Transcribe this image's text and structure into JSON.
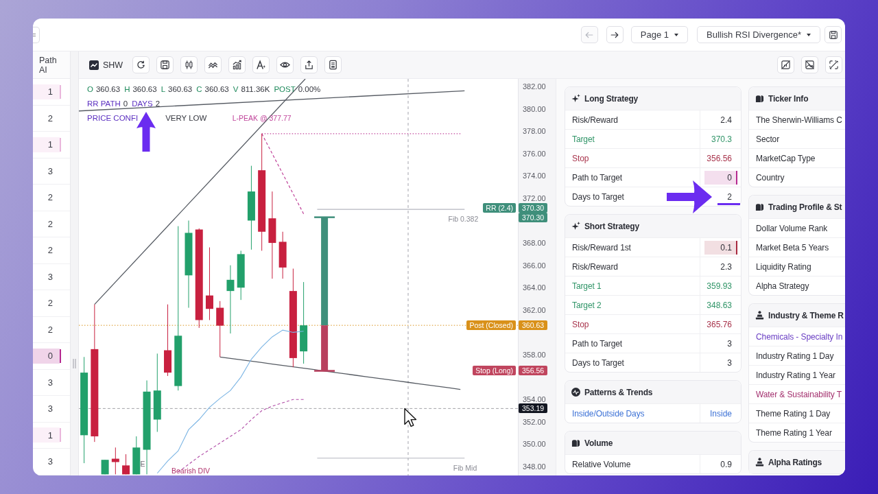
{
  "top_bar": {
    "back_button": {
      "disabled": true
    },
    "forward_button": {
      "disabled": false
    },
    "page_menu": {
      "value": "Page 1"
    },
    "scan_menu": {
      "value": "Bullish RSI Divergence*"
    }
  },
  "path_ai": {
    "header": "Path AI",
    "rows": [
      {
        "value": "1",
        "color": "#e9b6dc"
      },
      {
        "value": "2"
      },
      {
        "value": "1",
        "color": "#e9b6dc"
      },
      {
        "value": "3"
      },
      {
        "value": "2"
      },
      {
        "value": "2"
      },
      {
        "value": "2"
      },
      {
        "value": "3"
      },
      {
        "value": "2"
      },
      {
        "value": "2"
      },
      {
        "value": "0",
        "color": "#b5288f"
      },
      {
        "value": "3"
      },
      {
        "value": "3"
      },
      {
        "value": "1",
        "color": "#e9b6dc"
      },
      {
        "value": "3"
      }
    ]
  },
  "toolbar": {
    "symbol": "SHW"
  },
  "chart": {
    "info": {
      "quote": [
        {
          "key": "O",
          "value": "360.63"
        },
        {
          "key": "H",
          "value": "360.63"
        },
        {
          "key": "L",
          "value": "360.63"
        },
        {
          "key": "C",
          "value": "360.63"
        },
        {
          "key": "V",
          "value": "811.36K"
        },
        {
          "key": "POST",
          "value": "0.00%"
        }
      ],
      "path": [
        {
          "key": "RR PATH",
          "value": "0",
          "highlighted": false
        },
        {
          "key": "DAYS",
          "value": "2",
          "highlighted": true
        }
      ],
      "confidence": {
        "key": "PRICE CONFI",
        "value": "VERY LOW"
      }
    },
    "chart_data": {
      "type": "candlestick",
      "tick_labels": "y",
      "ylim": [
        347.2,
        382.67
      ],
      "yticks": [
        {
          "value": 382,
          "label": "382.00"
        },
        {
          "value": 380,
          "label": "380.00"
        },
        {
          "value": 378,
          "label": "378.00"
        },
        {
          "value": 376,
          "label": "376.00"
        },
        {
          "value": 374,
          "label": "374.00"
        },
        {
          "value": 372,
          "label": "372.00"
        },
        {
          "value": 368,
          "label": "368.00"
        },
        {
          "value": 366,
          "label": "366.00"
        },
        {
          "value": 364,
          "label": "364.00"
        },
        {
          "value": 362,
          "label": "362.00"
        },
        {
          "value": 358,
          "label": "358.00"
        },
        {
          "value": 354,
          "label": "354.00"
        },
        {
          "value": 352,
          "label": "352.00"
        },
        {
          "value": 350,
          "label": "350.00"
        },
        {
          "value": 348,
          "label": "348.00"
        }
      ],
      "categories": [
        null,
        null,
        null,
        null,
        null,
        null,
        null,
        null,
        null,
        null,
        null,
        null,
        null,
        null,
        null,
        null,
        null,
        null,
        null,
        null,
        null,
        null,
        null,
        null,
        null,
        null,
        null,
        null,
        null,
        null,
        null,
        null,
        null,
        null,
        null,
        null,
        null,
        null,
        null,
        null,
        null,
        null
      ],
      "ohlc": [
        [
          350.8,
          357.8,
          348.3,
          356.4
        ],
        [
          358.5,
          362.5,
          350.2,
          350.7
        ],
        [
          347.3,
          348.6,
          347.3,
          348.6
        ],
        [
          348.7,
          349.7,
          347.3,
          348.4
        ],
        [
          348.1,
          349.1,
          347.3,
          347.3
        ],
        [
          347.3,
          350.7,
          347.3,
          349.7
        ],
        [
          349.5,
          355.7,
          347.3,
          354.7
        ],
        [
          352.2,
          358.1,
          351.1,
          354.8
        ],
        [
          358.4,
          362.5,
          356.1,
          356.4
        ],
        [
          355.2,
          369.5,
          354.8,
          359.7
        ],
        [
          365.1,
          370.0,
          362.2,
          368.9
        ],
        [
          369.2,
          369.3,
          360.4,
          361.1
        ],
        [
          363.3,
          367.6,
          361.1,
          362.1
        ],
        [
          362.2,
          362.8,
          357.8,
          360.6
        ],
        [
          363.7,
          366.0,
          359.9,
          364.7
        ],
        [
          364.0,
          367.3,
          362.9,
          367.0
        ],
        [
          370.0,
          374.9,
          367.4,
          372.6
        ],
        [
          374.5,
          377.77,
          367.3,
          369.0
        ],
        [
          370.2,
          372.6,
          364.8,
          368.0
        ],
        [
          368.1,
          369.0,
          364.8,
          365.8
        ],
        [
          363.7,
          365.7,
          356.9,
          357.7
        ],
        [
          358.3,
          364.5,
          357.2,
          360.63
        ],
        null,
        null,
        null,
        null,
        null,
        null,
        null,
        null,
        null,
        null,
        null,
        null,
        null,
        null,
        null,
        null,
        null,
        null,
        null,
        null
      ],
      "series": [
        {
          "type": "line",
          "color": "#7cb5e4",
          "line_style": "solid",
          "values": [
            null,
            null,
            null,
            null,
            null,
            null,
            null,
            347.4,
            348.5,
            349.4,
            351.3,
            352.2,
            353.3,
            354.1,
            354.8,
            356.0,
            357.6,
            358.7,
            359.6,
            360.2,
            360.0,
            360.1,
            null,
            null,
            null,
            null,
            null,
            null,
            null,
            null,
            null,
            null,
            null,
            null,
            null,
            null,
            null,
            null,
            null,
            null,
            null,
            null
          ]
        },
        {
          "type": "line",
          "color": "#b04aa6",
          "line_style": "dashed",
          "values": [
            null,
            null,
            null,
            null,
            null,
            null,
            null,
            null,
            null,
            347.5,
            348.2,
            348.9,
            349.5,
            350.1,
            350.7,
            351.3,
            352.2,
            353.0,
            353.4,
            353.7,
            354.0,
            354.0,
            null,
            null,
            null,
            null,
            null,
            null,
            null,
            null,
            null,
            null,
            null,
            null,
            null,
            null,
            null,
            null,
            null,
            null,
            null,
            null
          ]
        },
        {
          "type": "line",
          "color": "#555a62",
          "line_style": "solid",
          "values": [
            null,
            null,
            null,
            null,
            null,
            null,
            null,
            null,
            null,
            null,
            null,
            null,
            null,
            357.8,
            357.67,
            357.55,
            357.42,
            357.3,
            357.17,
            357.04,
            356.92,
            356.79,
            356.67,
            356.54,
            356.41,
            356.29,
            356.16,
            356.03,
            355.91,
            355.78,
            355.66,
            355.53,
            355.4,
            355.28,
            355.15,
            355.03,
            354.9,
            null,
            null,
            null,
            null,
            null
          ]
        },
        {
          "type": "line",
          "color": "#c0449a",
          "line_style": "dashed",
          "values": [
            null,
            null,
            null,
            null,
            null,
            null,
            null,
            null,
            null,
            null,
            null,
            null,
            null,
            null,
            null,
            null,
            null,
            377.77,
            375.98,
            374.19,
            372.39,
            370.6,
            null,
            null,
            null,
            null,
            null,
            null,
            null,
            null,
            null,
            null,
            null,
            null,
            null,
            null,
            null,
            null,
            null,
            null,
            null,
            null
          ]
        },
        {
          "type": "line",
          "color": "#c0449a",
          "line_style": "dotted",
          "values": [
            null,
            null,
            null,
            null,
            null,
            null,
            null,
            null,
            null,
            null,
            null,
            null,
            null,
            null,
            null,
            null,
            null,
            377.77,
            377.77,
            377.77,
            377.77,
            377.77,
            377.77,
            377.77,
            377.77,
            377.77,
            377.77,
            377.77,
            377.77,
            377.77,
            377.77,
            377.77,
            377.77,
            377.77,
            377.77,
            377.77,
            377.77,
            null,
            null,
            null,
            null,
            null
          ]
        }
      ],
      "ref_lines": [
        {
          "axis": "y",
          "value": 360.63,
          "label": "Post (Closed)",
          "color": "#d9911a",
          "line_style": "dotted"
        },
        {
          "axis": "y",
          "value": 353.19,
          "color": "#131722",
          "line_style": "dashed"
        }
      ],
      "annotations": [
        "L-PEAK @ 377.77",
        "Fib 0.382",
        "Fib Mid",
        "E",
        "Bearish DIV",
        "RR (2.4)",
        "370.30",
        "370.30",
        "360.63",
        "Stop (Long)",
        "356.56",
        "353.19"
      ]
    }
  },
  "panels": [
    {
      "cards": [
        {
          "title": "Long Strategy",
          "rows": [
            {
              "label": "Risk/Reward",
              "value": "2.4",
              "kind": "plain",
              "highlighted": false
            },
            {
              "label": "Target",
              "value": "370.3",
              "kind": "positive",
              "highlighted": false
            },
            {
              "label": "Stop",
              "value": "356.56",
              "kind": "negative",
              "highlighted": false
            },
            {
              "label": "Path to Target",
              "value": "0",
              "kind": "plain",
              "color": "#b5288f",
              "highlighted": false
            },
            {
              "label": "Days to Target",
              "value": "2",
              "kind": "plain",
              "highlighted": true
            }
          ]
        },
        {
          "title": "Short Strategy",
          "rows": [
            {
              "label": "Risk/Reward 1st",
              "value": "0.1",
              "kind": "plain",
              "color": "#a8283e",
              "highlighted": false
            },
            {
              "label": "Risk/Reward",
              "value": "2.3",
              "kind": "plain",
              "highlighted": false
            },
            {
              "label": "Target 1",
              "value": "359.93",
              "kind": "positive",
              "highlighted": false
            },
            {
              "label": "Target 2",
              "value": "348.63",
              "kind": "positive",
              "highlighted": false
            },
            {
              "label": "Stop",
              "value": "365.76",
              "kind": "negative",
              "highlighted": false
            },
            {
              "label": "Path to Target",
              "value": "3",
              "kind": "plain",
              "highlighted": false
            },
            {
              "label": "Days to Target",
              "value": "3",
              "kind": "plain",
              "highlighted": false
            }
          ]
        },
        {
          "title": "Patterns & Trends",
          "rows": [
            {
              "label": "Inside/Outside Days",
              "value": "Inside",
              "kind": "link",
              "highlighted": false
            }
          ]
        },
        {
          "title": "Volume",
          "rows": [
            {
              "label": "Relative Volume",
              "value": "0.9",
              "kind": "plain",
              "highlighted": false
            }
          ]
        }
      ]
    },
    {
      "cards": [
        {
          "title": "Ticker Info",
          "rows": [
            {
              "label": "The Sherwin-Williams C",
              "kind": "plain",
              "highlighted": false
            },
            {
              "label": "Sector",
              "kind": "plain",
              "highlighted": false
            },
            {
              "label": "MarketCap Type",
              "kind": "plain",
              "highlighted": false
            },
            {
              "label": "Country",
              "kind": "plain",
              "highlighted": false
            }
          ]
        },
        {
          "title": "Trading Profile & St",
          "rows": [
            {
              "label": "Dollar Volume Rank",
              "kind": "plain",
              "highlighted": false
            },
            {
              "label": "Market Beta 5 Years",
              "kind": "plain",
              "highlighted": false
            },
            {
              "label": "Liquidity Rating",
              "kind": "plain",
              "highlighted": false
            },
            {
              "label": "Alpha Strategy",
              "kind": "plain",
              "highlighted": false
            }
          ]
        },
        {
          "title": "Industry & Theme R",
          "rows": [
            {
              "label": "Chemicals - Specialty In",
              "kind": "industry",
              "highlighted": false
            },
            {
              "label": "Industry Rating 1 Day",
              "kind": "plain",
              "highlighted": false
            },
            {
              "label": "Industry Rating 1 Year",
              "kind": "plain",
              "highlighted": false
            },
            {
              "label": "Water & Sustainability T",
              "kind": "theme",
              "highlighted": false
            },
            {
              "label": "Theme Rating 1 Day",
              "kind": "plain",
              "highlighted": false
            },
            {
              "label": "Theme Rating 1 Year",
              "kind": "plain",
              "highlighted": false
            }
          ]
        },
        {
          "title": "Alpha Ratings"
        }
      ]
    }
  ]
}
